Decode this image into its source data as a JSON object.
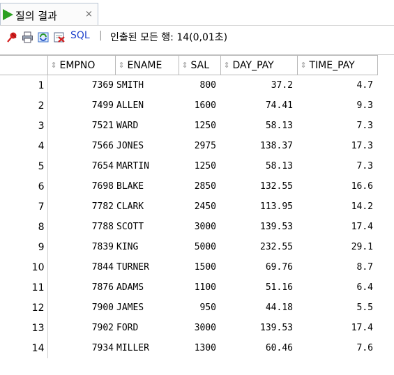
{
  "tab": {
    "title": "질의 결과",
    "close": "×",
    "icon": "run-icon"
  },
  "toolbar": {
    "pin_icon": "pin-icon",
    "print_icon": "print-icon",
    "refresh_icon": "refresh-sql-icon",
    "export_icon": "export-icon",
    "sql_label": "SQL",
    "separator": "|",
    "status": "인출된 모든 행: 14(0,01초)"
  },
  "colors": {
    "sql_link": "#2244cc",
    "play": "#2aa020"
  },
  "table": {
    "columns": [
      "EMPNO",
      "ENAME",
      "SAL",
      "DAY_PAY",
      "TIME_PAY"
    ],
    "rows": [
      {
        "n": "1",
        "empno": "7369",
        "ename": "SMITH",
        "sal": "800",
        "day": "37.2",
        "time": "4.7"
      },
      {
        "n": "2",
        "empno": "7499",
        "ename": "ALLEN",
        "sal": "1600",
        "day": "74.41",
        "time": "9.3"
      },
      {
        "n": "3",
        "empno": "7521",
        "ename": "WARD",
        "sal": "1250",
        "day": "58.13",
        "time": "7.3"
      },
      {
        "n": "4",
        "empno": "7566",
        "ename": "JONES",
        "sal": "2975",
        "day": "138.37",
        "time": "17.3"
      },
      {
        "n": "5",
        "empno": "7654",
        "ename": "MARTIN",
        "sal": "1250",
        "day": "58.13",
        "time": "7.3"
      },
      {
        "n": "6",
        "empno": "7698",
        "ename": "BLAKE",
        "sal": "2850",
        "day": "132.55",
        "time": "16.6"
      },
      {
        "n": "7",
        "empno": "7782",
        "ename": "CLARK",
        "sal": "2450",
        "day": "113.95",
        "time": "14.2"
      },
      {
        "n": "8",
        "empno": "7788",
        "ename": "SCOTT",
        "sal": "3000",
        "day": "139.53",
        "time": "17.4"
      },
      {
        "n": "9",
        "empno": "7839",
        "ename": "KING",
        "sal": "5000",
        "day": "232.55",
        "time": "29.1"
      },
      {
        "n": "10",
        "empno": "7844",
        "ename": "TURNER",
        "sal": "1500",
        "day": "69.76",
        "time": "8.7"
      },
      {
        "n": "11",
        "empno": "7876",
        "ename": "ADAMS",
        "sal": "1100",
        "day": "51.16",
        "time": "6.4"
      },
      {
        "n": "12",
        "empno": "7900",
        "ename": "JAMES",
        "sal": "950",
        "day": "44.18",
        "time": "5.5"
      },
      {
        "n": "13",
        "empno": "7902",
        "ename": "FORD",
        "sal": "3000",
        "day": "139.53",
        "time": "17.4"
      },
      {
        "n": "14",
        "empno": "7934",
        "ename": "MILLER",
        "sal": "1300",
        "day": "60.46",
        "time": "7.6"
      }
    ]
  }
}
